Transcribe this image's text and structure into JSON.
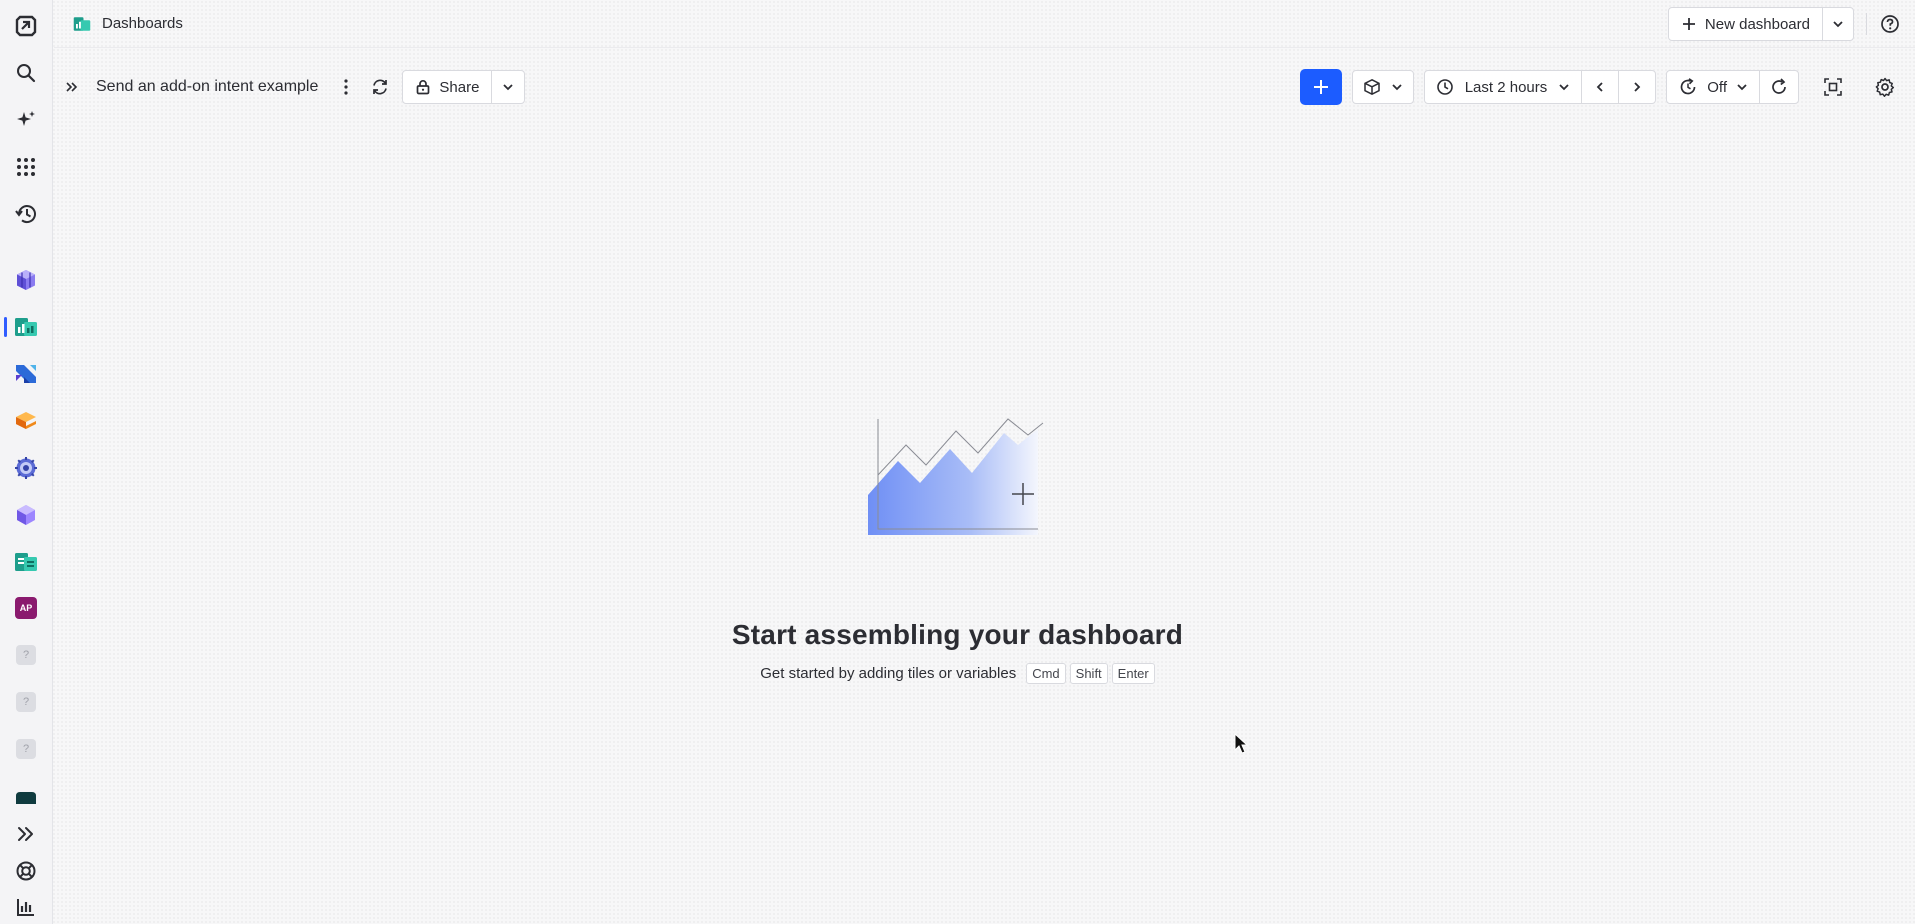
{
  "sidebar": {
    "icons": [
      "app-logo-icon",
      "search-icon",
      "sparkle-icon",
      "apps-grid-icon",
      "history-icon",
      "cube-app-icon",
      "dashboards-app-icon",
      "workflows-app-icon",
      "stack-app-icon",
      "gear-app-icon",
      "hexagon-app-icon",
      "notebooks-app-icon",
      "ap-app-icon",
      "unknown-app-icon",
      "unknown-app-icon",
      "unknown-app-icon",
      "terminal-app-icon",
      "expand-icon",
      "support-icon",
      "chart-icon"
    ],
    "ap_label": "AP",
    "unknown_label": "?"
  },
  "header": {
    "title": "Dashboards",
    "new_dashboard_label": "New dashboard"
  },
  "toolbar": {
    "dashboard_title": "Send an add-on intent example",
    "share_label": "Share",
    "timeframe_label": "Last 2 hours",
    "refresh_label": "Off"
  },
  "empty_state": {
    "title": "Start assembling your dashboard",
    "subtitle": "Get started by adding tiles or variables",
    "shortcut": [
      "Cmd",
      "Shift",
      "Enter"
    ]
  },
  "colors": {
    "accent": "#1c5cff",
    "active_indicator": "#2f5cff",
    "illustration_gradient": "#6f8ff5"
  }
}
